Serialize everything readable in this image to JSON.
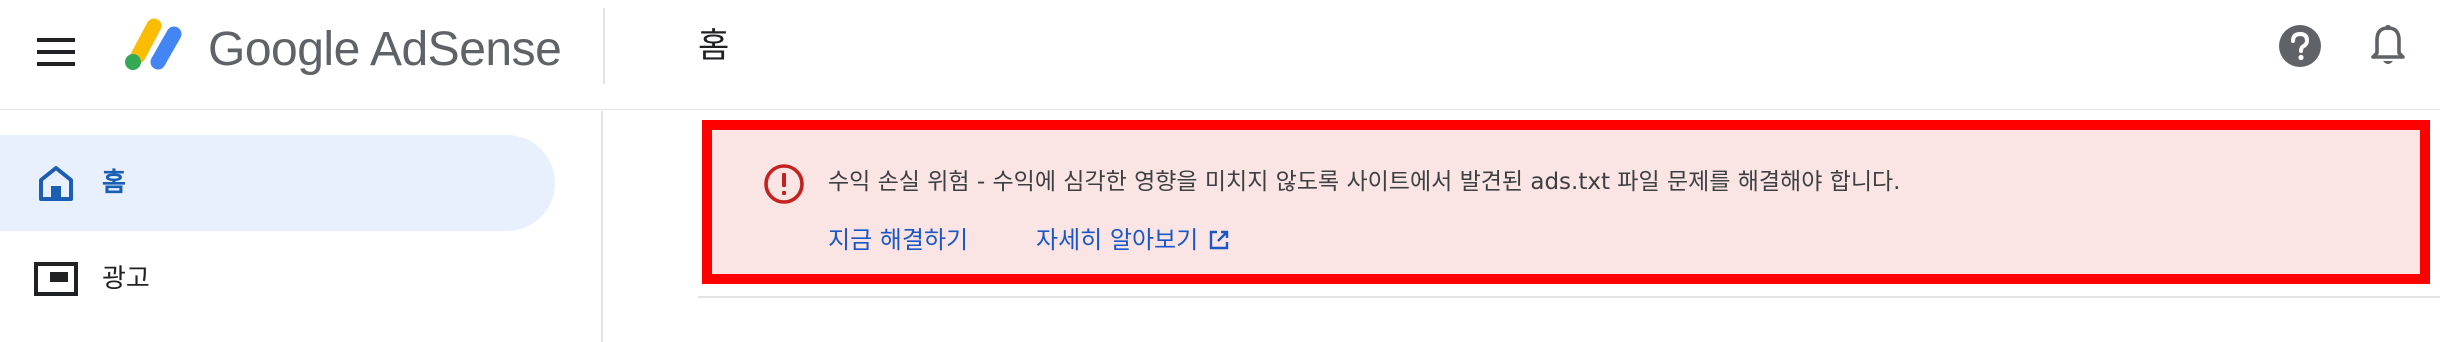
{
  "header": {
    "brand": "Google AdSense",
    "page_title": "홈"
  },
  "sidebar": {
    "items": [
      {
        "label": "홈",
        "icon": "home-icon",
        "active": true
      },
      {
        "label": "광고",
        "icon": "ad-unit-icon",
        "active": false
      }
    ]
  },
  "alert": {
    "message": "수익 손실 위험 - 수익에 심각한 영향을 미치지 않도록 사이트에서 발견된 ads.txt 파일 문제를 해결해야 합니다.",
    "fix_link": "지금 해결하기",
    "learn_link": "자세히 알아보기"
  },
  "colors": {
    "accent": "#1a73e8",
    "error": "#c5221f",
    "alert_background": "#fbe5e4",
    "highlight_border": "#ff0000",
    "active_nav_background": "#e8f0fe"
  }
}
